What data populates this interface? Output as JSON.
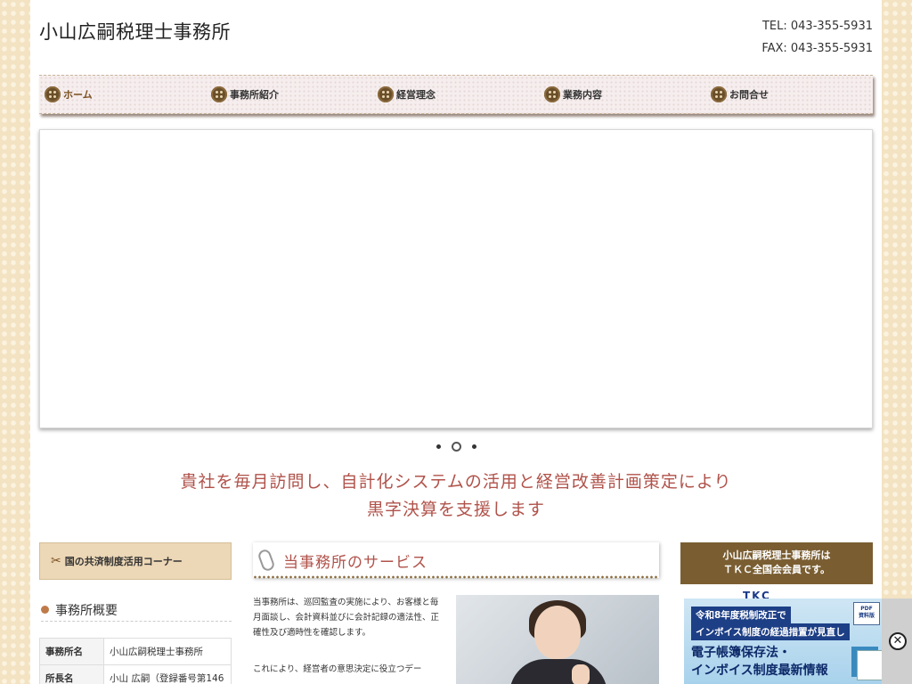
{
  "header": {
    "site_title": "小山広嗣税理士事務所",
    "tel": "TEL: 043-355-5931",
    "fax": "FAX: 043-355-5931"
  },
  "nav": {
    "items": [
      {
        "label": "ホーム"
      },
      {
        "label": "事務所紹介"
      },
      {
        "label": "経営理念"
      },
      {
        "label": "業務内容"
      },
      {
        "label": "お問合せ"
      }
    ],
    "active_index": 0
  },
  "slider": {
    "dot_count": 3,
    "active_dot": 2
  },
  "catch": {
    "line1": "貴社を毎月訪問し、自計化システムの活用と経営改善計画策定により",
    "line2": "黒字決算を支援します"
  },
  "left": {
    "kyosai_button": "国の共済制度活用コーナー",
    "office_heading": "事務所概要",
    "info": [
      {
        "key": "事務所名",
        "value": "小山広嗣税理士事務所"
      },
      {
        "key": "所長名",
        "value": "小山 広嗣（登録番号第146"
      }
    ]
  },
  "center": {
    "service_title": "当事務所のサービス",
    "paragraph1": "当事務所は、巡回監査の実施により、お客様と毎月面談し、会計資料並びに会計記録の適法性、正確性及び適時性を確認します。",
    "paragraph2": "これにより、経営者の意思決定に役立つデー"
  },
  "right": {
    "tkc_line1": "小山広嗣税理士事務所は",
    "tkc_line2": "ＴＫＣ全国会会員です。",
    "tkc_logo": "TKC"
  },
  "ad": {
    "line1": "令和8年度税制改正で",
    "line2": "インボイス制度の経過措置が見直し",
    "line3": "電子帳簿保存法・",
    "line4": "インボイス制度最新情報",
    "pdf_badge": "PDF\n資料版",
    "close_symbol": "✕"
  },
  "colors": {
    "catch_text": "#b0524a",
    "tkc_box": "#7a5e32",
    "ad_navy": "#1d3f86"
  }
}
